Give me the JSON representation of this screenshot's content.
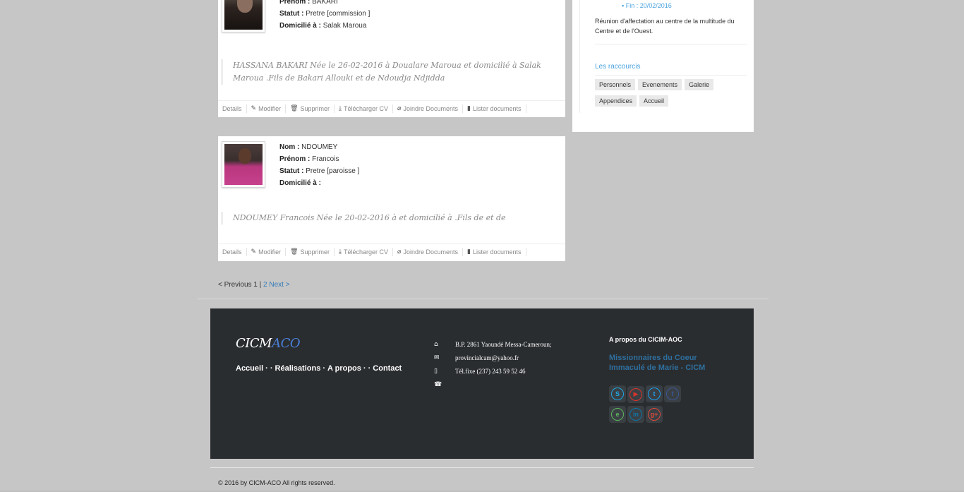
{
  "cards": [
    {
      "prenom_label": "Prenom :",
      "prenom": "BAKARI",
      "statut_label": "Statut :",
      "statut": "Pretre [commission ]",
      "domicile_label": "Domicilié à :",
      "domicile": "Salak Maroua",
      "description": "HASSANA BAKARI Née le 26-02-2016 à Doualare Maroua et domicilié à Salak Maroua .Fils de Bakari Allouki et de Ndoudja Ndjidda",
      "actions": [
        "Details",
        "Modifier",
        "Supprimer",
        "Télécharger CV",
        "Joindre Documents",
        "Lister documents"
      ]
    },
    {
      "nom_label": "Nom :",
      "nom": "NDOUMEY",
      "prenom_label": "Prénom :",
      "prenom": "Francois",
      "statut_label": "Statut :",
      "statut": "Pretre [paroisse ]",
      "domicile_label": "Domicilié à :",
      "domicile": "",
      "description": "NDOUMEY Francois Née le 20-02-2016 à et domicilié à .Fils de et de",
      "actions": [
        "Details",
        "Modifier",
        "Supprimer",
        "Télécharger CV",
        "Joindre Documents",
        "Lister documents"
      ]
    }
  ],
  "sidebar": {
    "fin": "Fin : 20/02/2016",
    "event_text": "Réunion d'affectation au centre de la multitude du Centre et de l'Ouest.",
    "shortcuts_title": "Les raccourcis",
    "shortcuts": [
      "Personnels",
      "Evenements",
      "Galerie",
      "Appendices",
      "Accueil"
    ]
  },
  "pagination": {
    "previous": "< Previous",
    "current": "1",
    "separator": "|",
    "page2": "2",
    "next": "Next >"
  },
  "footer": {
    "logo_main": "CICM",
    "logo_accent": "ACO",
    "nav": [
      "Accueil",
      "Réalisations",
      "A propos",
      "Contact"
    ],
    "contact": {
      "address": "B.P.   2861   Yaoundé   Messa-Cameroun;",
      "email": "provincialcam@yahoo.fr",
      "phone": "Tél.fixe   (237)   243   59   52   46",
      "fax": ""
    },
    "about_title": "A propos du CICIM-AOC",
    "about_name": "Missionnaires du Coeur Immaculé de Marie - CICM",
    "social": [
      {
        "name": "skype-icon",
        "glyph": "S",
        "color": "#1ea7e1"
      },
      {
        "name": "youtube-icon",
        "glyph": "▶",
        "color": "#d9342b"
      },
      {
        "name": "twitter-icon",
        "glyph": "t",
        "color": "#1da1f2"
      },
      {
        "name": "facebook-icon",
        "glyph": "f",
        "color": "#3b5998"
      },
      {
        "name": "evernote-icon",
        "glyph": "e",
        "color": "#5cb85c"
      },
      {
        "name": "linkedin-icon",
        "glyph": "in",
        "color": "#0e76a8"
      },
      {
        "name": "googleplus-icon",
        "glyph": "g+",
        "color": "#dd4b39"
      }
    ]
  },
  "copyright": "© 2016 by CICM-ACO All rights reserved."
}
